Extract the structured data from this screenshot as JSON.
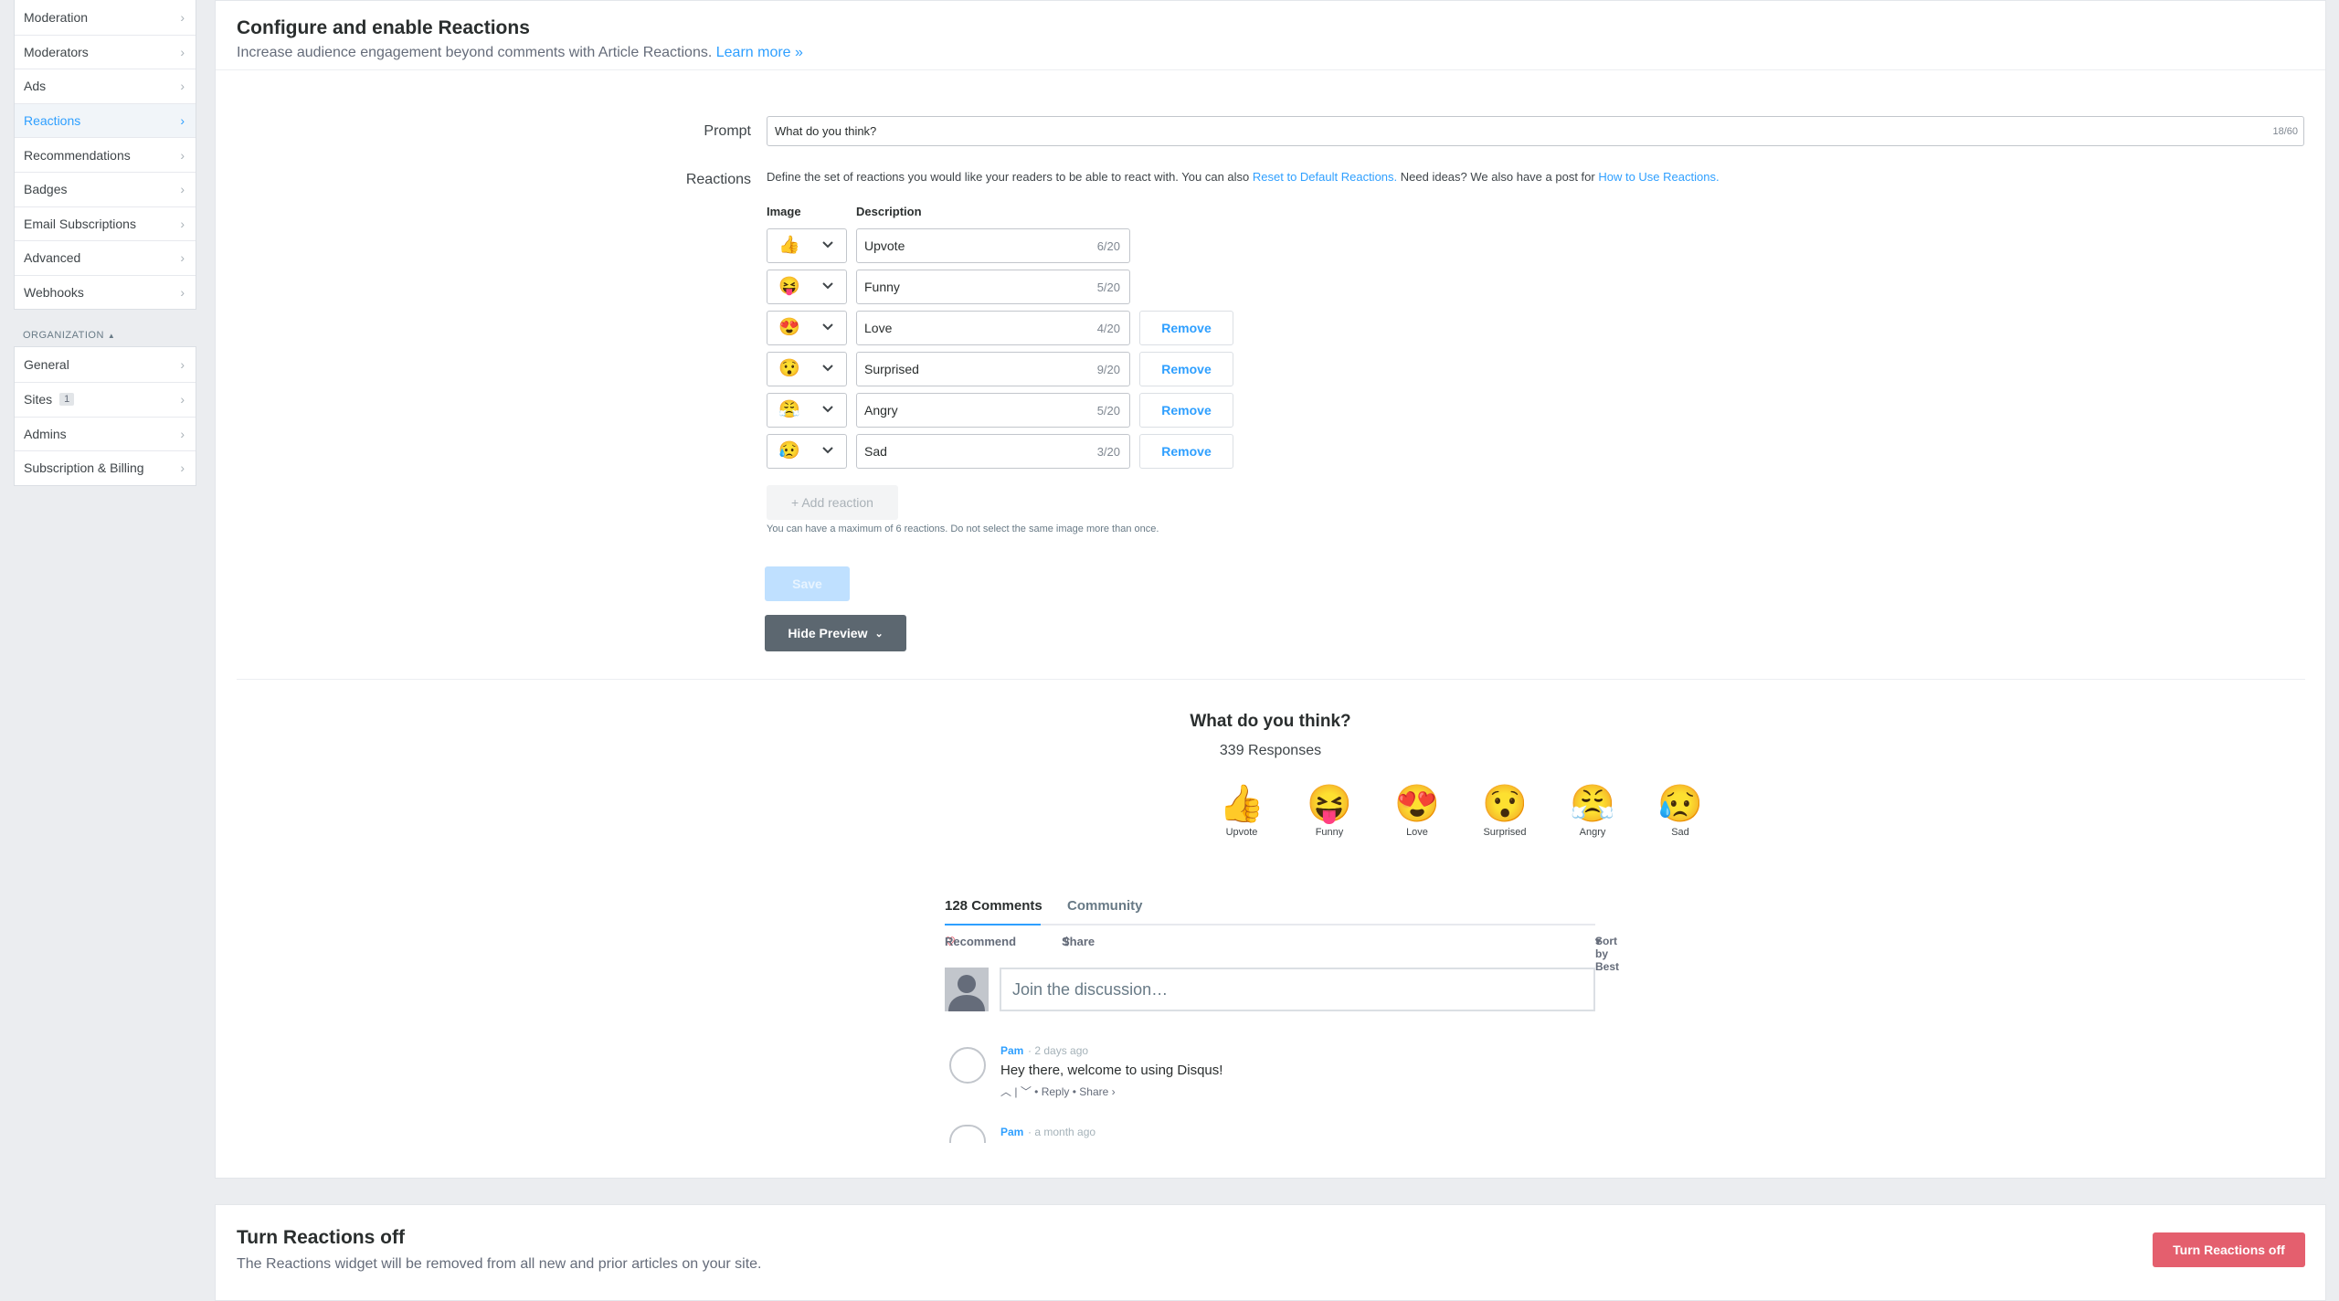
{
  "sidebar": {
    "main_items": [
      {
        "label": "Moderation"
      },
      {
        "label": "Moderators"
      },
      {
        "label": "Ads"
      },
      {
        "label": "Reactions"
      },
      {
        "label": "Recommendations"
      },
      {
        "label": "Badges"
      },
      {
        "label": "Email Subscriptions"
      },
      {
        "label": "Advanced"
      },
      {
        "label": "Webhooks"
      }
    ],
    "active": "Reactions",
    "org_label": "ORGANIZATION",
    "org_items": [
      {
        "label": "General"
      },
      {
        "label": "Sites",
        "badge": "1"
      },
      {
        "label": "Admins"
      },
      {
        "label": "Subscription & Billing"
      }
    ]
  },
  "config": {
    "title": "Configure and enable Reactions",
    "subtitle": "Increase audience engagement beyond comments with Article Reactions.",
    "learn_more": "Learn more »",
    "prompt_label": "Prompt",
    "prompt_value": "What do you think?",
    "prompt_count": "18/60",
    "reactions_label": "Reactions",
    "help_1": "Define the set of reactions you would like your readers to be able to react with. You can also",
    "help_link_1": "Reset to Default Reactions.",
    "help_2": "Need ideas? We also have a post for",
    "help_link_2": "How to Use Reactions.",
    "col_image": "Image",
    "col_description": "Description",
    "reactions": [
      {
        "emoji": "👍",
        "icon": "thumbs-up-icon",
        "description": "Upvote",
        "count": "6/20",
        "removable": false
      },
      {
        "emoji": "😝",
        "icon": "tongue-out-icon",
        "description": "Funny",
        "count": "5/20",
        "removable": false
      },
      {
        "emoji": "😍",
        "icon": "heart-eyes-icon",
        "description": "Love",
        "count": "4/20",
        "removable": true
      },
      {
        "emoji": "😯",
        "icon": "surprised-icon",
        "description": "Surprised",
        "count": "9/20",
        "removable": true
      },
      {
        "emoji": "😤",
        "icon": "angry-icon",
        "description": "Angry",
        "count": "5/20",
        "removable": true
      },
      {
        "emoji": "😥",
        "icon": "sad-icon",
        "description": "Sad",
        "count": "3/20",
        "removable": true
      }
    ],
    "remove_label": "Remove",
    "add_reaction": "+ Add reaction",
    "max_note": "You can have a maximum of 6 reactions. Do not select the same image more than once.",
    "save": "Save",
    "hide_preview": "Hide Preview"
  },
  "preview": {
    "title": "What do you think?",
    "responses": "339 Responses",
    "reactions": [
      {
        "emoji": "👍",
        "label": "Upvote"
      },
      {
        "emoji": "😝",
        "label": "Funny"
      },
      {
        "emoji": "😍",
        "label": "Love"
      },
      {
        "emoji": "😯",
        "label": "Surprised"
      },
      {
        "emoji": "😤",
        "label": "Angry"
      },
      {
        "emoji": "😥",
        "label": "Sad"
      }
    ],
    "tab_comments": "128 Comments",
    "tab_community": "Community",
    "recommend": "Recommend",
    "share": "Share",
    "sort": "Sort by Best",
    "join_placeholder": "Join the discussion…",
    "comments": [
      {
        "author": "Pam",
        "time": "2 days ago",
        "text": "Hey there, welcome to using Disqus!",
        "reply": "Reply",
        "share": "Share ›"
      },
      {
        "author": "Pam",
        "time": "a month ago"
      }
    ]
  },
  "turn_off": {
    "title": "Turn Reactions off",
    "subtitle": "The Reactions widget will be removed from all new and prior articles on your site.",
    "button": "Turn Reactions off"
  },
  "colors": {
    "accent": "#2e9fff",
    "danger": "#e45f6e",
    "preview_button": "#5c6770"
  }
}
